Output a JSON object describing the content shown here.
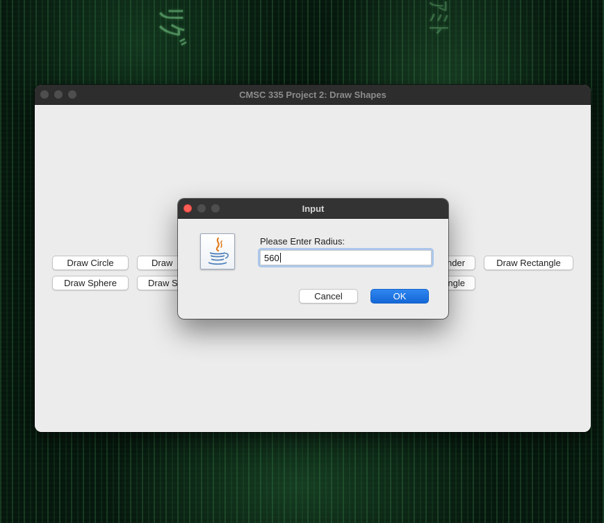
{
  "main_window": {
    "title": "CMSC 335 Project 2: Draw Shapes",
    "buttons": {
      "draw_circle": "Draw Circle",
      "draw_sphere": "Draw Sphere",
      "draw_row1_col2_partial": "Draw",
      "draw_row2_col2_partial": "Draw S",
      "row1_col4_partial": "nder",
      "row2_col4_partial": "ngle",
      "draw_rectangle": "Draw Rectangle"
    }
  },
  "dialog": {
    "title": "Input",
    "icon": "java-coffee-cup-icon",
    "prompt": "Please Enter Radius:",
    "input_value": "560",
    "cancel_label": "Cancel",
    "ok_label": "OK"
  },
  "colors": {
    "close_button": "#ff5f57",
    "ok_button": "#1a6fe0",
    "input_focus_ring": "#78aaeb"
  }
}
